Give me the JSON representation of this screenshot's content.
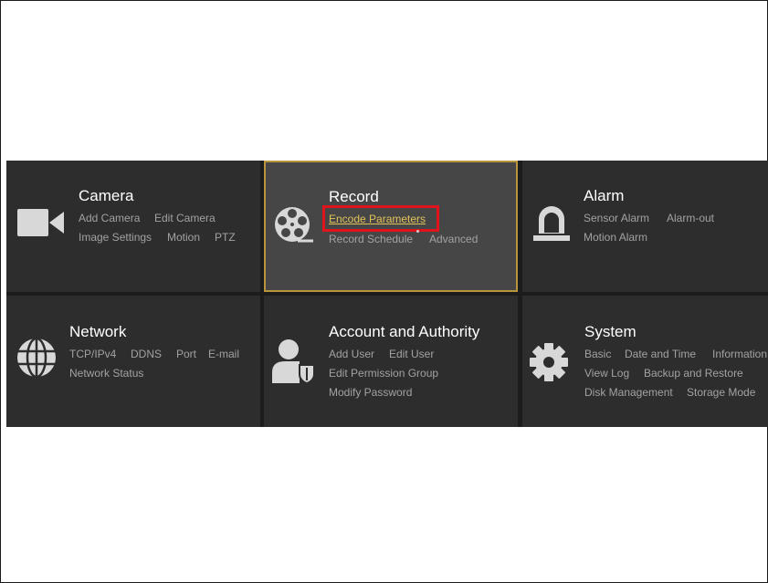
{
  "colors": {
    "page_background": "#ffffff",
    "panel_background": "#1c1c1c",
    "tile_background": "#2d2d2d",
    "selected_tile_background": "#464646",
    "selected_tile_border": "#b8953a",
    "title_text": "#ffffff",
    "item_text": "#a2a2a2",
    "active_item_text": "#e1c25a",
    "highlight_box": "#e0141c"
  },
  "tiles": {
    "camera": {
      "icon": "video-camera-icon",
      "title": "Camera",
      "items": [
        "Add Camera",
        "Edit Camera",
        "Image Settings",
        "Motion",
        "PTZ"
      ]
    },
    "record": {
      "icon": "film-reel-icon",
      "title": "Record",
      "selected": true,
      "items": [
        "Encode Parameters",
        "Record Schedule",
        "Advanced"
      ],
      "active_item": "Encode Parameters"
    },
    "alarm": {
      "icon": "alarm-siren-icon",
      "title": "Alarm",
      "items": [
        "Sensor Alarm",
        "Alarm-out",
        "Motion Alarm"
      ]
    },
    "network": {
      "icon": "globe-icon",
      "title": "Network",
      "items": [
        "TCP/IPv4",
        "DDNS",
        "Port",
        "E-mail",
        "Network Status"
      ]
    },
    "account": {
      "icon": "user-shield-icon",
      "title": "Account and Authority",
      "items": [
        "Add User",
        "Edit User",
        "Edit Permission Group",
        "Modify Password"
      ]
    },
    "system": {
      "icon": "gear-icon",
      "title": "System",
      "items": [
        "Basic",
        "Date and Time",
        "Information",
        "View Log",
        "Backup and Restore",
        "Disk Management",
        "Storage Mode"
      ]
    }
  }
}
